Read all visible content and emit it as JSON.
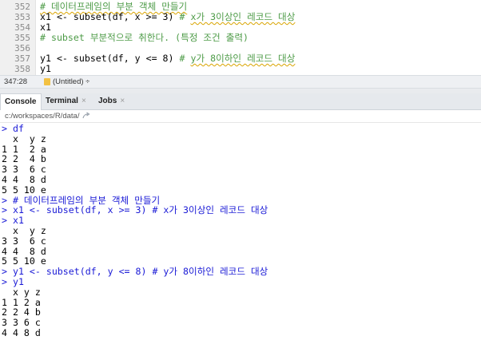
{
  "editor": {
    "lines": [
      {
        "num": "352",
        "code": "",
        "comment": "# 데이터프레임의 부분 객체 만들기",
        "squiggle": ""
      },
      {
        "num": "353",
        "code": "x1 <- subset(df, x >= 3) ",
        "comment": "# ",
        "squiggle": "x가 3이상인 레코드 대상"
      },
      {
        "num": "354",
        "code": "x1",
        "comment": "",
        "squiggle": ""
      },
      {
        "num": "355",
        "code": "",
        "comment": "# subset 부분적으로 취한다. (특정 조건 출력)",
        "squiggle": ""
      },
      {
        "num": "356",
        "code": "",
        "comment": "",
        "squiggle": ""
      },
      {
        "num": "357",
        "code": "y1 <- subset(df, y <= 8) ",
        "comment": "# ",
        "squiggle": "y가 8이하인 레코드 대상"
      },
      {
        "num": "358",
        "code": "y1",
        "comment": "",
        "squiggle": ""
      }
    ]
  },
  "statusbar": {
    "position": "347:28",
    "context": "(Untitled) ÷"
  },
  "tabs": [
    {
      "label": "Console",
      "close": ""
    },
    {
      "label": "Terminal",
      "close": "×"
    },
    {
      "label": "Jobs",
      "close": "×"
    }
  ],
  "path": "c:/workspaces/R/data/",
  "console": {
    "lines": [
      {
        "type": "in",
        "text": "> df"
      },
      {
        "type": "out",
        "text": "  x  y z"
      },
      {
        "type": "out",
        "text": "1 1  2 a"
      },
      {
        "type": "out",
        "text": "2 2  4 b"
      },
      {
        "type": "out",
        "text": "3 3  6 c"
      },
      {
        "type": "out",
        "text": "4 4  8 d"
      },
      {
        "type": "out",
        "text": "5 5 10 e"
      },
      {
        "type": "in",
        "text": "> # 데이터프레임의 부분 객체 만들기"
      },
      {
        "type": "in",
        "text": "> x1 <- subset(df, x >= 3) # x가 3이상인 레코드 대상"
      },
      {
        "type": "in",
        "text": "> x1"
      },
      {
        "type": "out",
        "text": "  x  y z"
      },
      {
        "type": "out",
        "text": "3 3  6 c"
      },
      {
        "type": "out",
        "text": "4 4  8 d"
      },
      {
        "type": "out",
        "text": "5 5 10 e"
      },
      {
        "type": "in",
        "text": "> y1 <- subset(df, y <= 8) # y가 8이하인 레코드 대상"
      },
      {
        "type": "in",
        "text": "> y1"
      },
      {
        "type": "out",
        "text": "  x y z"
      },
      {
        "type": "out",
        "text": "1 1 2 a"
      },
      {
        "type": "out",
        "text": "2 2 4 b"
      },
      {
        "type": "out",
        "text": "3 3 6 c"
      },
      {
        "type": "out",
        "text": "4 4 8 d"
      }
    ]
  }
}
